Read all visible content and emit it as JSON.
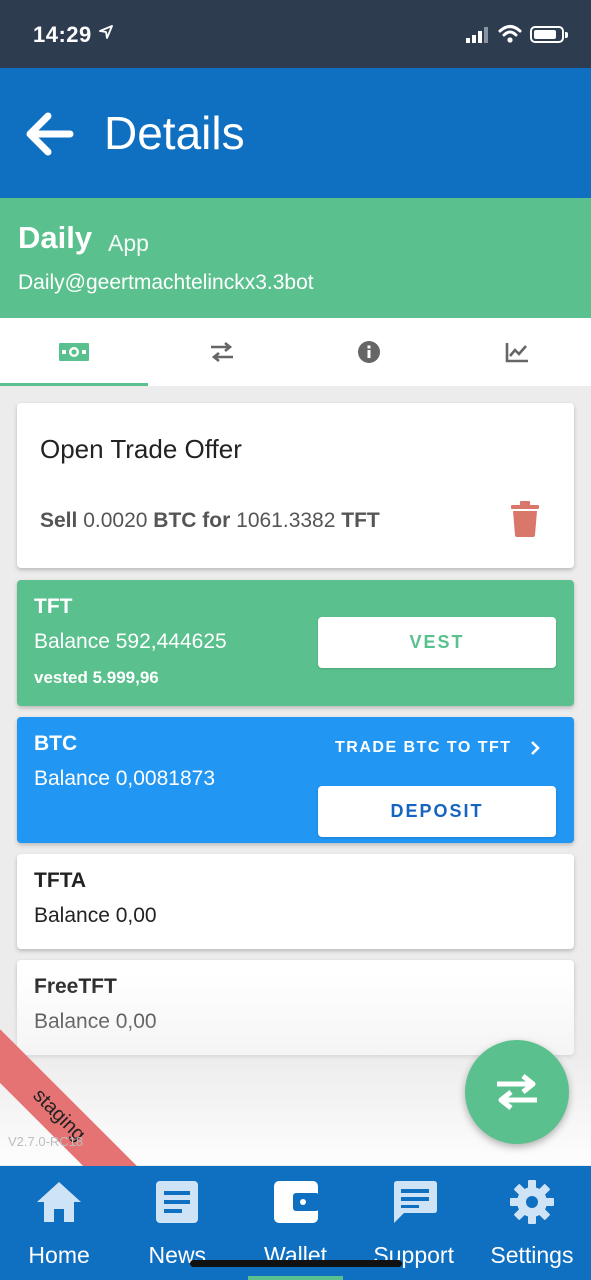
{
  "status_bar": {
    "time": "14:29"
  },
  "app_bar": {
    "title": "Details"
  },
  "wallet": {
    "name": "Daily",
    "type": "App",
    "address": "Daily@geertmachtelinckx3.3bot"
  },
  "tabs": [
    {
      "icon": "money-icon",
      "active": true
    },
    {
      "icon": "swap-icon",
      "active": false
    },
    {
      "icon": "info-icon",
      "active": false
    },
    {
      "icon": "chart-icon",
      "active": false
    }
  ],
  "offer": {
    "title": "Open Trade Offer",
    "sell_word": "Sell",
    "sell_amount": "0.0020",
    "sell_coin": "BTC",
    "for_word": "for",
    "buy_amount": "1061.3382",
    "buy_coin": "TFT"
  },
  "coins": {
    "tft": {
      "name": "TFT",
      "balance": "Balance 592,444625",
      "vested": "vested 5.999,96",
      "button": "VEST"
    },
    "btc": {
      "name": "BTC",
      "balance": "Balance 0,0081873",
      "trade": "TRADE BTC TO TFT",
      "button": "DEPOSIT"
    },
    "tfta": {
      "name": "TFTA",
      "balance": "Balance 0,00"
    },
    "freetft": {
      "name": "FreeTFT",
      "balance": "Balance 0,00"
    }
  },
  "staging": {
    "label": "staging",
    "version": "V2.7.0-RC18"
  },
  "nav": [
    {
      "label": "Home",
      "icon": "home-icon"
    },
    {
      "label": "News",
      "icon": "news-icon"
    },
    {
      "label": "Wallet",
      "icon": "wallet-icon"
    },
    {
      "label": "Support",
      "icon": "chat-icon"
    },
    {
      "label": "Settings",
      "icon": "gear-icon"
    }
  ],
  "colors": {
    "primary": "#0f6fc1",
    "green": "#5ac08d",
    "btc": "#2196f3",
    "delete": "#d9776b"
  }
}
